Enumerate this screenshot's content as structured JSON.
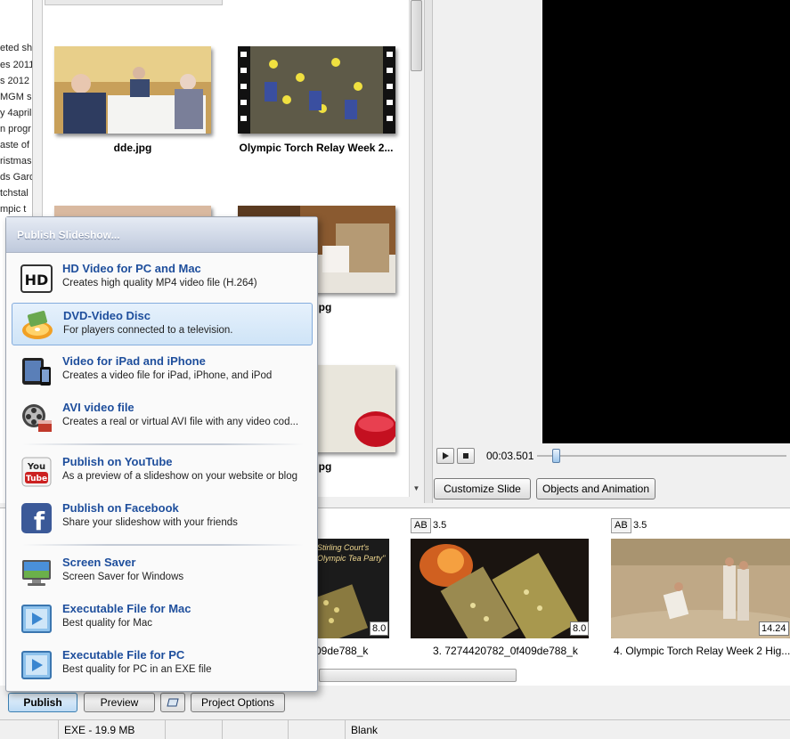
{
  "left_tree": {
    "items": [
      "eted sh",
      "es 2011",
      "s 2012",
      "MGM s",
      "y 4april",
      "n progr",
      "aste of",
      "ristmas",
      "ds Gard",
      "tchstal",
      "mpic t"
    ]
  },
  "file_browser": {
    "files": [
      {
        "label": "dde.jpg"
      },
      {
        "label": "Olympic Torch Relay Week 2..."
      },
      {
        "label": ""
      },
      {
        "label": "56.jpg"
      },
      {
        "label": ""
      },
      {
        "label": "58.jpg"
      }
    ]
  },
  "preview": {
    "time": "00:03.501",
    "customize_slide": "Customize Slide",
    "objects_animation": "Objects and Animation"
  },
  "timeline": {
    "slides": [
      {
        "caption": "09de788_k",
        "duration": "8.0",
        "image_text": "Stirling Court's\nOlympic Tea Party\""
      },
      {
        "caption": "3. 7274420782_0f409de788_k",
        "duration": "8.0",
        "ab": "AB",
        "transition": "3.5"
      },
      {
        "caption": "4. Olympic Torch Relay Week 2 Hig...",
        "duration": "14.24",
        "ab": "AB",
        "transition": "3.5"
      }
    ]
  },
  "publish_menu": {
    "header": "Publish Slideshow...",
    "items": [
      {
        "title": "HD Video for PC and Mac",
        "subtitle": "Creates high quality MP4 video file (H.264)",
        "icon": "hd-icon"
      },
      {
        "title": "DVD-Video Disc",
        "subtitle": "For players connected to a television.",
        "icon": "dvd-icon"
      },
      {
        "title": "Video for iPad and iPhone",
        "subtitle": "Creates a video file for iPad, iPhone, and iPod",
        "icon": "ipad-icon"
      },
      {
        "title": "AVI video file",
        "subtitle": "Creates a real or virtual AVI file with any video cod...",
        "icon": "film-reel-icon"
      },
      {
        "title": "Publish on YouTube",
        "subtitle": "As a preview of a slideshow on your website or blog",
        "icon": "youtube-icon"
      },
      {
        "title": "Publish on Facebook",
        "subtitle": "Share your slideshow with your friends",
        "icon": "facebook-icon"
      },
      {
        "title": "Screen Saver",
        "subtitle": "Screen Saver for Windows",
        "icon": "monitor-icon"
      },
      {
        "title": "Executable File for Mac",
        "subtitle": "Best quality for Mac",
        "icon": "play-file-icon"
      },
      {
        "title": "Executable File for PC",
        "subtitle": "Best quality for PC in an EXE file",
        "icon": "play-file-icon"
      }
    ]
  },
  "toolbar": {
    "publish": "Publish",
    "preview": "Preview",
    "project_options": "Project Options"
  },
  "status": {
    "size": "EXE - 19.9 MB",
    "theme": "Blank"
  }
}
